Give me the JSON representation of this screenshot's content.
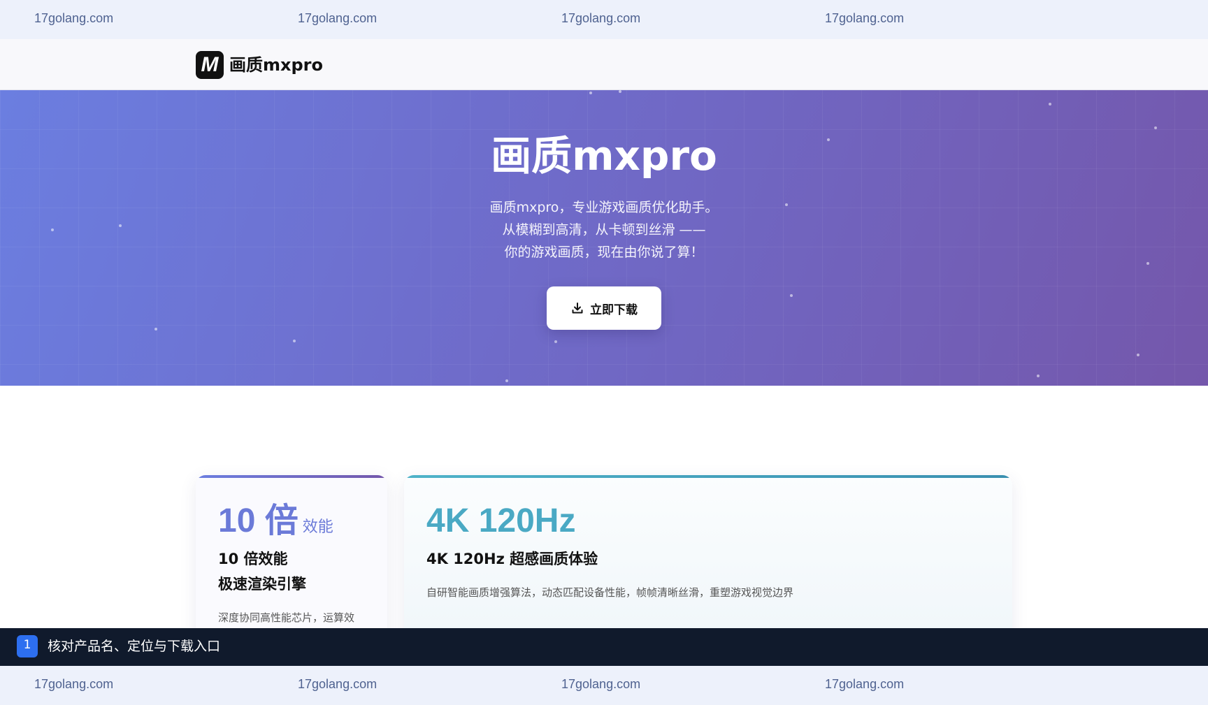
{
  "watermark": {
    "top": [
      "17golang.com",
      "17golang.com",
      "17golang.com",
      "17golang.com"
    ],
    "bottom": [
      "17golang.com",
      "17golang.com",
      "17golang.com",
      "17golang.com"
    ]
  },
  "header": {
    "logo_letter": "M",
    "logo_text": "画质mxpro"
  },
  "hero": {
    "title": "画质mxpro",
    "lines": [
      "画质mxpro，专业游戏画质优化助手。",
      "从模糊到高清，从卡顿到丝滑 ——",
      "你的游戏画质，现在由你说了算！"
    ],
    "download_label": "立即下载",
    "download_icon": "download-icon"
  },
  "cards": [
    {
      "big": "10 倍",
      "unit": "效能",
      "title_lines": [
        "10 倍效能",
        "极速渲染引擎"
      ],
      "desc": "深度协同高性能芯片，运算效"
    },
    {
      "big": "4K 120Hz",
      "title_lines": [
        "4K 120Hz 超感画质体验"
      ],
      "desc": "自研智能画质增强算法，动态匹配设备性能，帧帧清晰丝滑，重塑游戏视觉边界"
    }
  ],
  "step": {
    "number": "1",
    "label": "核对产品名、定位与下载入口"
  },
  "colors": {
    "hero_start": "#6b7ee0",
    "hero_end": "#7457ab",
    "accent_blue": "#6b7ad8",
    "accent_teal": "#4aa9c4",
    "step_badge": "#2d6ff0",
    "step_bar": "#101a2c"
  }
}
